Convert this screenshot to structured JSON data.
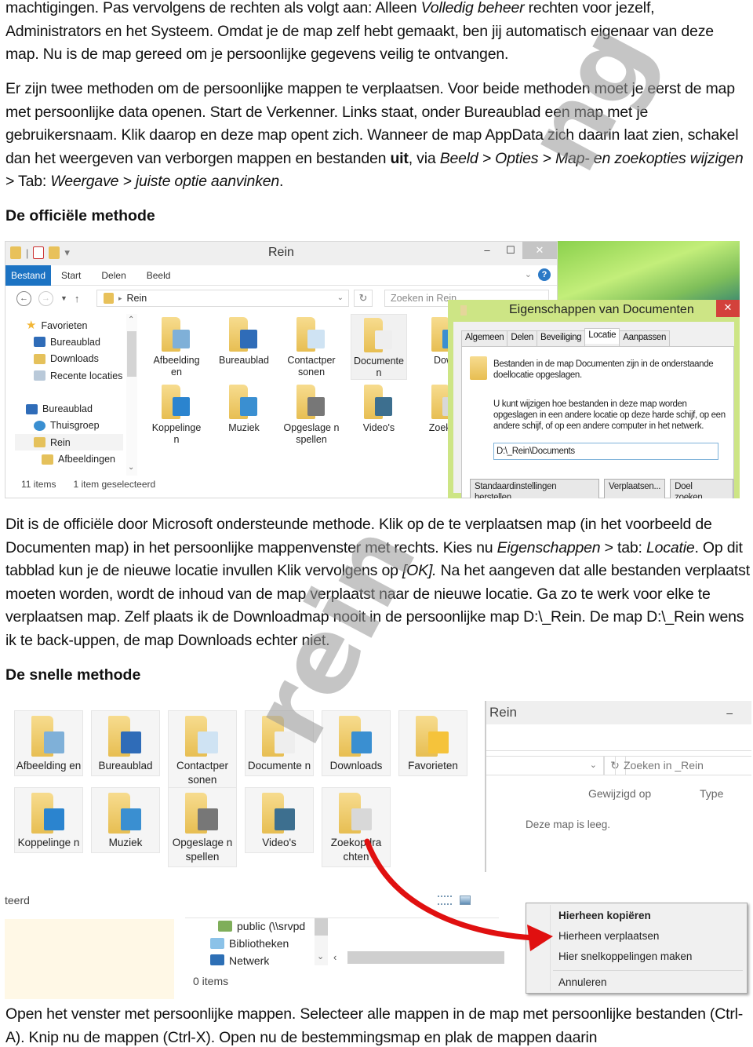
{
  "paragraphs": {
    "p1": {
      "pre": "machtigingen. Pas vervolgens de rechten als volgt aan: Alleen ",
      "italic": "Volledig beheer",
      "post": " rechten voor jezelf, Administrators en het Systeem. Omdat je de map zelf hebt gemaakt, ben jij automatisch eigenaar van deze map. Nu is de map gereed om je persoonlijke gegevens veilig te ontvangen."
    },
    "p2": {
      "text": "Er zijn twee methoden om de persoonlijke mappen te verplaatsen. Voor beide methoden moet je eerst de map met persoonlijke data openen. Start de Verkenner. Links staat, onder Bureaublad een map met je gebruikersnaam. Klik daarop en deze map opent zich.  Wanneer de map AppData zich daarin laat zien, schakel dan het weergeven van verborgen mappen en bestanden ",
      "bold": "uit",
      "mid": ", via ",
      "italic1": "Beeld > Opties > Map- en zoekopties wijzigen",
      "mid2": " > Tab: ",
      "italic2": "Weergave > juiste optie aanvinken",
      "end": "."
    },
    "heading1": "De officiële methode",
    "p3": {
      "pre": "Dit is de officiële door Microsoft ondersteunde methode. Klik op de te verplaatsen map (in het voorbeeld de Documenten map) in het persoonlijke mappenvenster met rechts. Kies nu ",
      "italic1": "Eigenschappen",
      "mid1": " > tab: ",
      "italic2": "Locatie",
      "mid2": ". Op dit tabblad kun je de nieuwe locatie invullen Klik vervolgens op ",
      "italic3": "[OK].",
      "post": " Na het aangeven dat alle bestanden verplaatst moeten worden, wordt de inhoud van de map verplaatst naar de nieuwe locatie. Ga zo te werk voor elke te verplaatsen map. Zelf plaats ik de Downloadmap nooit in de persoonlijke map D:\\_Rein. De map D:\\_Rein wens ik te back-uppen, de map Downloads echter niet."
    },
    "heading2": "De snelle methode",
    "p4": "Open het venster met persoonlijke mappen. Selecteer alle mappen in de map met persoonlijke bestanden (Ctrl-A). Knip nu de mappen (Ctrl-X). Open nu de bestemmingsmap en plak de mappen daarin"
  },
  "explorer1": {
    "title": "Rein",
    "window_buttons": {
      "minimize": "–",
      "maximize": "☐",
      "close": "✕"
    },
    "ribbon_tabs": [
      "Bestand",
      "Start",
      "Delen",
      "Beeld"
    ],
    "help": "?",
    "address": "Rein",
    "search_placeholder": "Zoeken in Rein",
    "sidebar": [
      {
        "label": "Favorieten",
        "icon": "star-icon"
      },
      {
        "label": "Bureaublad",
        "icon": "desktop-icon"
      },
      {
        "label": "Downloads",
        "icon": "downloads-folder-icon"
      },
      {
        "label": "Recente locaties",
        "icon": "recent-places-icon"
      },
      {
        "label": "",
        "icon": ""
      },
      {
        "label": "Bureaublad",
        "icon": "desktop-icon"
      },
      {
        "label": "Thuisgroep",
        "icon": "homegroup-icon"
      },
      {
        "label": "Rein",
        "icon": "user-folder-icon",
        "selected": true
      },
      {
        "label": "Afbeeldingen",
        "icon": "pictures-folder-icon"
      }
    ],
    "folders": [
      {
        "label": "Afbeelding en",
        "icon": "pictures-folder-icon"
      },
      {
        "label": "Bureaublad",
        "icon": "desktop-folder-icon"
      },
      {
        "label": "Contactper sonen",
        "icon": "contacts-folder-icon"
      },
      {
        "label": "Documente n",
        "icon": "documents-folder-icon",
        "selected": true
      },
      {
        "label": "Down",
        "icon": "downloads-folder-icon"
      },
      {
        "label": "Koppelinge n",
        "icon": "links-folder-icon"
      },
      {
        "label": "Muziek",
        "icon": "music-folder-icon"
      },
      {
        "label": "Opgeslage n spellen",
        "icon": "saved-games-folder-icon"
      },
      {
        "label": "Video's",
        "icon": "videos-folder-icon"
      },
      {
        "label": "Zoek ch",
        "icon": "searches-folder-icon"
      }
    ],
    "status_items": "11 items",
    "status_selected": "1 item geselecteerd"
  },
  "dialog": {
    "title": "Eigenschappen van Documenten",
    "close": "✕",
    "tabs": [
      "Algemeen",
      "Delen",
      "Beveiliging",
      "Locatie",
      "Aanpassen"
    ],
    "active_tab": "Locatie",
    "text1": "Bestanden in de map Documenten zijn in de onderstaande doellocatie opgeslagen.",
    "text2": "U kunt wijzigen hoe bestanden in deze map worden opgeslagen in een andere locatie op deze harde schijf, op een andere schijf, of op een andere computer in het netwerk.",
    "path_value": "D:\\_Rein\\Documents",
    "buttons": [
      "Standaardinstellingen herstellen",
      "Verplaatsen...",
      "Doel zoeken..."
    ]
  },
  "screenshot2": {
    "tiles": [
      {
        "label": "Afbeelding en",
        "icon": "pictures-folder-icon"
      },
      {
        "label": "Bureaublad",
        "icon": "desktop-folder-icon"
      },
      {
        "label": "Contactper sonen",
        "icon": "contacts-folder-icon"
      },
      {
        "label": "Documente n",
        "icon": "documents-folder-icon"
      },
      {
        "label": "Downloads",
        "icon": "downloads-folder-icon"
      },
      {
        "label": "Favorieten",
        "icon": "favorites-folder-icon"
      },
      {
        "label": "Koppelinge n",
        "icon": "links-folder-icon"
      },
      {
        "label": "Muziek",
        "icon": "music-folder-icon"
      },
      {
        "label": "Opgeslage n spellen",
        "icon": "saved-games-folder-icon"
      },
      {
        "label": "Video's",
        "icon": "videos-folder-icon"
      },
      {
        "label": "Zoekopdra chten",
        "icon": "searches-folder-icon"
      }
    ],
    "window_title": "Rein",
    "minimize": "–",
    "search_placeholder": "Zoeken in _Rein",
    "columns": [
      "Gewijzigd op",
      "Type"
    ],
    "empty_text": "Deze map is leeg.",
    "status_fragment": "teerd",
    "nav_items": [
      {
        "label": "public (\\\\srvpd",
        "icon": "network-drive-icon"
      },
      {
        "label": "Bibliotheken",
        "icon": "libraries-icon"
      },
      {
        "label": "Netwerk",
        "icon": "network-icon"
      }
    ],
    "count": "0 items",
    "context_menu": [
      "Hierheen kopiëren",
      "Hierheen verplaatsen",
      "Hier snelkoppelingen maken",
      "Annuleren"
    ]
  },
  "watermark": {
    "top": "ng",
    "bottom": "rein"
  },
  "colors": {
    "ribbon_file": "#1c73c3",
    "dialog_frame": "#cde585",
    "dialog_close": "#d3413b",
    "arrow": "#e01010"
  }
}
